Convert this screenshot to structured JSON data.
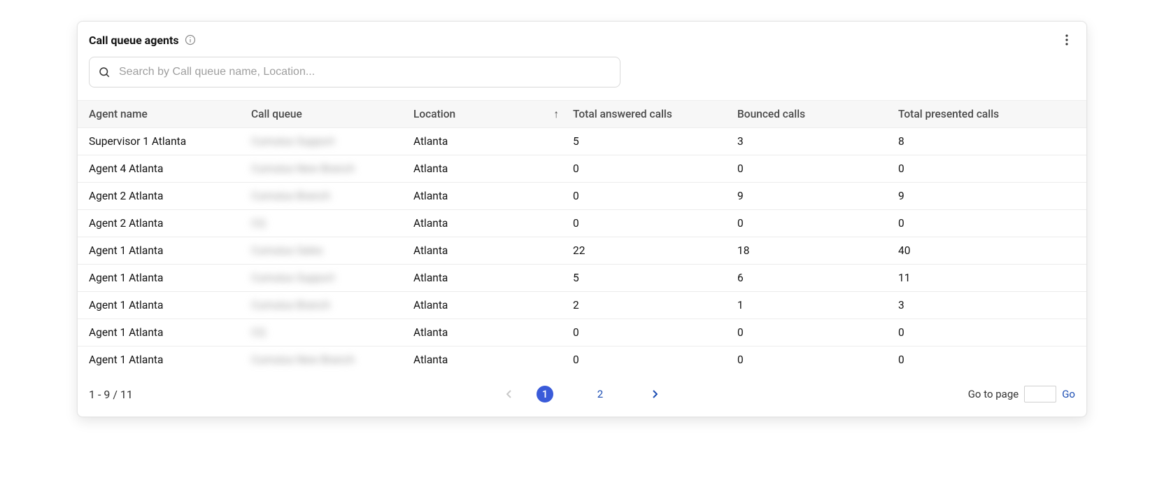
{
  "header": {
    "title": "Call queue agents"
  },
  "search": {
    "placeholder": "Search by Call queue name, Location...",
    "value": ""
  },
  "columns": {
    "agent": "Agent name",
    "queue": "Call queue",
    "location": "Location",
    "answered": "Total answered calls",
    "bounced": "Bounced calls",
    "presented": "Total presented calls",
    "sorted": "location",
    "sort_glyph": "↑"
  },
  "rows": [
    {
      "agent": "Supervisor 1 Atlanta",
      "queue": "Cumulus Support",
      "location": "Atlanta",
      "answered": "5",
      "bounced": "3",
      "presented": "8"
    },
    {
      "agent": "Agent 4 Atlanta",
      "queue": "Cumulus New Branch",
      "location": "Atlanta",
      "answered": "0",
      "bounced": "0",
      "presented": "0"
    },
    {
      "agent": "Agent 2 Atlanta",
      "queue": "Cumulus Branch",
      "location": "Atlanta",
      "answered": "0",
      "bounced": "9",
      "presented": "9"
    },
    {
      "agent": "Agent 2 Atlanta",
      "queue": "CQ",
      "location": "Atlanta",
      "answered": "0",
      "bounced": "0",
      "presented": "0"
    },
    {
      "agent": "Agent 1 Atlanta",
      "queue": "Cumulus Sales",
      "location": "Atlanta",
      "answered": "22",
      "bounced": "18",
      "presented": "40"
    },
    {
      "agent": "Agent 1 Atlanta",
      "queue": "Cumulus Support",
      "location": "Atlanta",
      "answered": "5",
      "bounced": "6",
      "presented": "11"
    },
    {
      "agent": "Agent 1 Atlanta",
      "queue": "Cumulus Branch",
      "location": "Atlanta",
      "answered": "2",
      "bounced": "1",
      "presented": "3"
    },
    {
      "agent": "Agent 1 Atlanta",
      "queue": "CQ",
      "location": "Atlanta",
      "answered": "0",
      "bounced": "0",
      "presented": "0"
    },
    {
      "agent": "Agent 1 Atlanta",
      "queue": "Cumulus New Branch",
      "location": "Atlanta",
      "answered": "0",
      "bounced": "0",
      "presented": "0"
    }
  ],
  "pagination": {
    "range": "1 - 9 / 11",
    "pages": [
      "1",
      "2"
    ],
    "current": "1",
    "goto_label": "Go to page",
    "go_label": "Go",
    "goto_value": ""
  }
}
